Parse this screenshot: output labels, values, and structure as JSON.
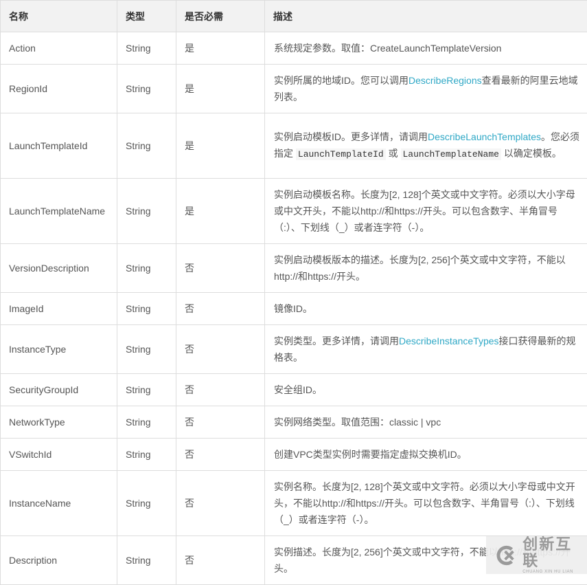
{
  "table": {
    "headers": [
      "名称",
      "类型",
      "是否必需",
      "描述"
    ],
    "rows": [
      {
        "name": "Action",
        "type": "String",
        "required": "是",
        "desc": [
          {
            "t": "系统规定参数。取值：CreateLaunchTemplateVersion"
          }
        ]
      },
      {
        "name": "RegionId",
        "type": "String",
        "required": "是",
        "desc": [
          {
            "t": "实例所属的地域ID。您可以调用"
          },
          {
            "t": "DescribeRegions",
            "link": true
          },
          {
            "t": "查看最新的阿里云地域列表。"
          }
        ]
      },
      {
        "name": "LaunchTemplateId",
        "type": "String",
        "required": "是",
        "desc": [
          {
            "t": "实例启动模板ID。更多详情，请调用"
          },
          {
            "t": "DescribeLaunchTemplates",
            "link": true
          },
          {
            "t": "。您必须指定 "
          },
          {
            "t": "LaunchTemplateId",
            "code": true
          },
          {
            "t": " 或 "
          },
          {
            "t": "LaunchTemplateName",
            "code": true
          },
          {
            "t": " 以确定模板。"
          }
        ]
      },
      {
        "name": "LaunchTemplateName",
        "type": "String",
        "required": "是",
        "desc": [
          {
            "t": "实例启动模板名称。长度为[2, 128]个英文或中文字符。必须以大小字母或中文开头，不能以http://和https://开头。可以包含数字、半角冒号（:）、下划线（_）或者连字符（-）。"
          }
        ]
      },
      {
        "name": "VersionDescription",
        "type": "String",
        "required": "否",
        "desc": [
          {
            "t": "实例启动模板版本的描述。长度为[2, 256]个英文或中文字符，不能以http://和https://开头。"
          }
        ]
      },
      {
        "name": "ImageId",
        "type": "String",
        "required": "否",
        "desc": [
          {
            "t": "镜像ID。"
          }
        ]
      },
      {
        "name": "InstanceType",
        "type": "String",
        "required": "否",
        "desc": [
          {
            "t": "实例类型。更多详情，请调用"
          },
          {
            "t": "DescribeInstanceTypes",
            "link": true
          },
          {
            "t": "接口获得最新的规格表。"
          }
        ]
      },
      {
        "name": "SecurityGroupId",
        "type": "String",
        "required": "否",
        "desc": [
          {
            "t": "安全组ID。"
          }
        ]
      },
      {
        "name": "NetworkType",
        "type": "String",
        "required": "否",
        "desc": [
          {
            "t": "实例网络类型。取值范围：classic | vpc"
          }
        ]
      },
      {
        "name": "VSwitchId",
        "type": "String",
        "required": "否",
        "desc": [
          {
            "t": "创建VPC类型实例时需要指定虚拟交换机ID。"
          }
        ]
      },
      {
        "name": "InstanceName",
        "type": "String",
        "required": "否",
        "desc": [
          {
            "t": "实例名称。长度为[2, 128]个英文或中文字符。必须以大小字母或中文开头，不能以http://和https://开头。可以包含数字、半角冒号（:）、下划线（_）或者连字符（-）。"
          }
        ]
      },
      {
        "name": "Description",
        "type": "String",
        "required": "否",
        "desc": [
          {
            "t": "实例描述。长度为[2, 256]个英文或中文字符，不能以http://和https://开头。"
          }
        ]
      }
    ]
  },
  "watermark": {
    "icon": "cx-logo-icon",
    "text_cn": "创新互联",
    "text_en": "CHUANG XIN HU LIAN"
  }
}
